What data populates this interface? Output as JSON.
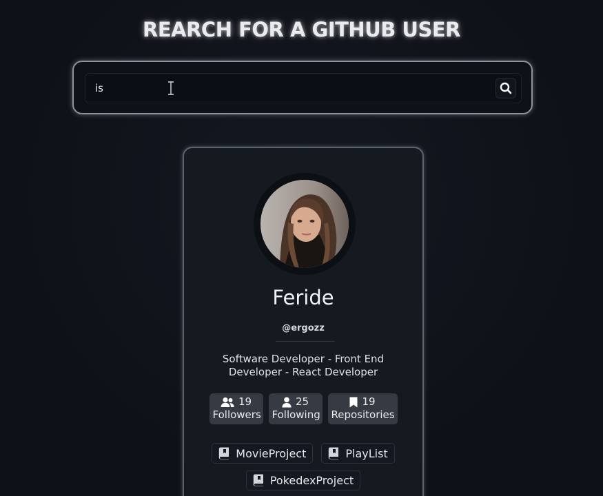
{
  "page": {
    "title": "REARCH FOR A GITHUB USER"
  },
  "search": {
    "value": "is"
  },
  "profile": {
    "name": "Feride",
    "login": "@ergozz",
    "bio": "Software Developer - Front End Developer - React Developer",
    "stats": [
      {
        "value": "19",
        "label": "Followers",
        "icon": "users-icon"
      },
      {
        "value": "25",
        "label": "Following",
        "icon": "user-icon"
      },
      {
        "value": "19",
        "label": "Repositories",
        "icon": "bookmark-icon"
      }
    ],
    "repos": [
      {
        "name": "MovieProject",
        "icon": "repo-book-icon"
      },
      {
        "name": "PlayList",
        "icon": "repo-book-icon"
      },
      {
        "name": "PokedexProject",
        "icon": "repo-book-icon"
      }
    ]
  },
  "colors": {
    "background": "#0f1218",
    "card": "#151920",
    "stat_badge": "#353a43",
    "text": "#e6e8ec"
  }
}
